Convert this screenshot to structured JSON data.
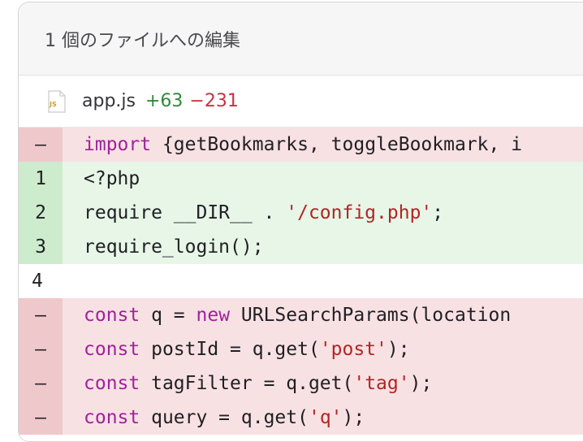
{
  "header": {
    "title": "1 個のファイルへの編集"
  },
  "file": {
    "icon": "javascript-file-icon",
    "icon_label": "JS",
    "name": "app.js",
    "added": "+63",
    "removed": "−231"
  },
  "colors": {
    "added_text": "#2f8a3a",
    "removed_text": "#c23440",
    "added_bg": "#e7f6e7",
    "removed_bg": "#f8e1e3",
    "keyword": "#a1219b",
    "string": "#b32424"
  },
  "lines": [
    {
      "type": "del",
      "gutter": "–",
      "tokens": [
        {
          "t": "kw",
          "v": "import"
        },
        {
          "t": "plain",
          "v": " {getBookmarks, toggleBookmark, i"
        }
      ]
    },
    {
      "type": "add",
      "gutter": "1",
      "tokens": [
        {
          "t": "plain",
          "v": "<?php"
        }
      ]
    },
    {
      "type": "add",
      "gutter": "2",
      "tokens": [
        {
          "t": "plain",
          "v": "require __DIR__ . "
        },
        {
          "t": "str",
          "v": "'/config.php'"
        },
        {
          "t": "plain",
          "v": ";"
        }
      ]
    },
    {
      "type": "add",
      "gutter": "3",
      "tokens": [
        {
          "t": "plain",
          "v": "require_login();"
        }
      ]
    },
    {
      "type": "ctx",
      "gutter": "4",
      "tokens": []
    },
    {
      "type": "del",
      "gutter": "–",
      "tokens": [
        {
          "t": "kw",
          "v": "const"
        },
        {
          "t": "plain",
          "v": " q = "
        },
        {
          "t": "kw",
          "v": "new"
        },
        {
          "t": "plain",
          "v": " URLSearchParams(location"
        }
      ]
    },
    {
      "type": "del",
      "gutter": "–",
      "tokens": [
        {
          "t": "kw",
          "v": "const"
        },
        {
          "t": "plain",
          "v": " postId = q.get("
        },
        {
          "t": "str",
          "v": "'post'"
        },
        {
          "t": "plain",
          "v": ");"
        }
      ]
    },
    {
      "type": "del",
      "gutter": "–",
      "tokens": [
        {
          "t": "kw",
          "v": "const"
        },
        {
          "t": "plain",
          "v": " tagFilter = q.get("
        },
        {
          "t": "str",
          "v": "'tag'"
        },
        {
          "t": "plain",
          "v": ");"
        }
      ]
    },
    {
      "type": "del",
      "gutter": "–",
      "tokens": [
        {
          "t": "kw",
          "v": "const"
        },
        {
          "t": "plain",
          "v": " query = q.get("
        },
        {
          "t": "str",
          "v": "'q'"
        },
        {
          "t": "plain",
          "v": ");"
        }
      ]
    }
  ]
}
